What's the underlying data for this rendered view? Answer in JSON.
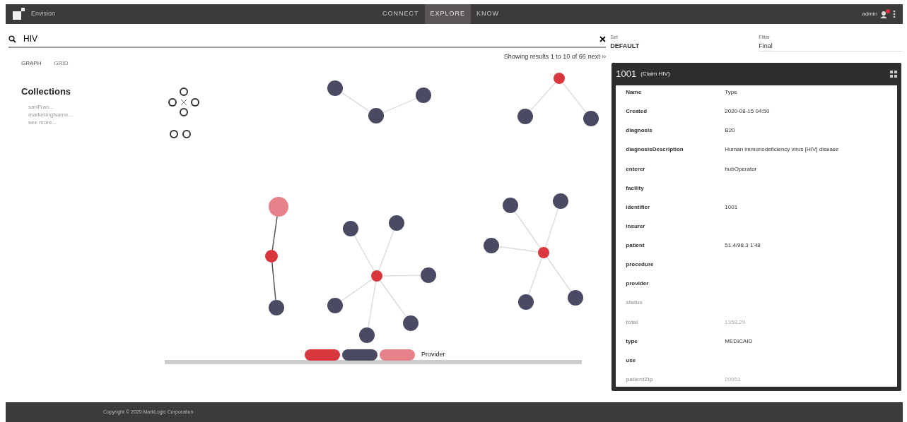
{
  "navbar": {
    "brand": "Envision",
    "tabs": [
      {
        "label": "CONNECT",
        "selected": false
      },
      {
        "label": "EXPLORE",
        "selected": true
      },
      {
        "label": "KNOW",
        "selected": false
      }
    ],
    "user": "admin"
  },
  "search": {
    "value": "HIV"
  },
  "set": {
    "label": "Set",
    "value": "DEFAULT"
  },
  "filter": {
    "label": "Filter",
    "value": "Final"
  },
  "view_toggle": [
    {
      "label": "GRAPH",
      "selected": true
    },
    {
      "label": "GRID",
      "selected": false
    }
  ],
  "collections": {
    "title": "Collections",
    "items": [
      "sanFran...",
      "marketingName...",
      "see more..."
    ]
  },
  "results": {
    "text": "Showing results 1 to 10 of 66",
    "next": "next ››"
  },
  "graph": {
    "nodes": [
      {
        "color": "#4a4a63"
      },
      {
        "color": "#4a4a63"
      },
      {
        "color": "#4a4a63"
      },
      {
        "color": "#d9363e"
      },
      {
        "color": "#4a4a63"
      },
      {
        "color": "#4a4a63"
      },
      {
        "color": "#e8828a"
      },
      {
        "color": "#d9363e"
      },
      {
        "color": "#4a4a63"
      },
      {
        "color": "#4a4a63"
      },
      {
        "color": "#4a4a63"
      },
      {
        "color": "#d9363e"
      },
      {
        "color": "#4a4a63"
      },
      {
        "color": "#4a4a63"
      },
      {
        "color": "#4a4a63"
      },
      {
        "color": "#4a4a63"
      },
      {
        "color": "#4a4a63"
      },
      {
        "color": "#4a4a63"
      },
      {
        "color": "#4a4a63"
      },
      {
        "color": "#d9363e"
      },
      {
        "color": "#4a4a63"
      },
      {
        "color": "#4a4a63"
      }
    ]
  },
  "legend": {
    "items": [
      {
        "color": "#d9363e"
      },
      {
        "color": "#4a4a63"
      },
      {
        "color": "#e8828a"
      }
    ],
    "text": "Provider"
  },
  "detail": {
    "title": "1001",
    "subtitle": "(Claim HIV)",
    "rows": [
      {
        "key": "Name",
        "value": "Type",
        "dimmed": false
      },
      {
        "key": "Created",
        "value": "2020-08-15 04:50",
        "dimmed": false
      },
      {
        "key": "diagnosis",
        "value": "B20",
        "dimmed": false
      },
      {
        "key": "diagnosisDescription",
        "value": "Human immunodeficiency virus [HIV] disease",
        "dimmed": false
      },
      {
        "key": "enterer",
        "value": "hubOperator",
        "dimmed": false
      },
      {
        "key": "facility",
        "dimmed": false
      },
      {
        "key": "identifier",
        "value": "1001",
        "dimmed": false
      },
      {
        "key": "insurer",
        "dimmed": false
      },
      {
        "key": "patient",
        "value": "51.4/98.3 1'48",
        "dimmed": false
      },
      {
        "key": "procedure",
        "dimmed": false
      },
      {
        "key": "provider",
        "dimmed": false
      },
      {
        "key": "status",
        "dimmed": true
      },
      {
        "key": "total",
        "value": "1358.29",
        "dimmed": true
      },
      {
        "key": "type",
        "value": "MEDICAID",
        "dimmed": false
      },
      {
        "key": "use",
        "dimmed": false
      },
      {
        "key": "patientZip",
        "value": "20051",
        "dimmed": true
      }
    ]
  },
  "footer": "Copyright © 2020 MarkLogic Corporation"
}
